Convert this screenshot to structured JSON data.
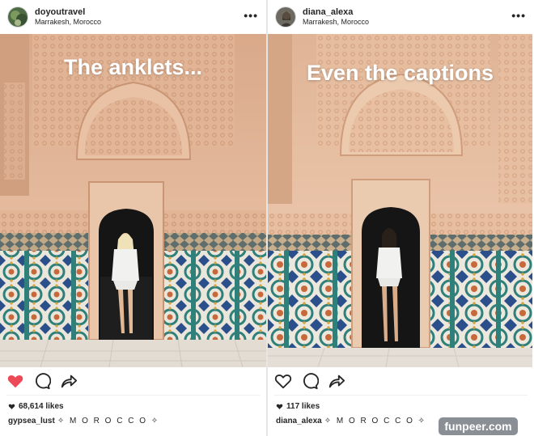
{
  "posts": [
    {
      "username": "doyoutravel",
      "location": "Marrakesh, Morocco",
      "more_label": "•••",
      "overlay_text": "The anklets...",
      "liked": true,
      "likes_text": "68,614 likes",
      "caption_user": "gypsea_lust",
      "caption_text": "✧ M O R O C C O ✧",
      "icons": [
        "heart-filled-icon",
        "comment-icon",
        "share-icon"
      ]
    },
    {
      "username": "diana_alexa",
      "location": "Marrakesh, Morocco",
      "more_label": "•••",
      "overlay_text": "Even the captions",
      "liked": false,
      "likes_text": "117 likes",
      "caption_user": "diana_alexa",
      "caption_text": "✧ M O R O C C O ✧",
      "icons": [
        "heart-outline-icon",
        "comment-icon",
        "share-icon"
      ]
    }
  ],
  "watermark": "funpeer.com",
  "colors": {
    "like_red": "#ed4956",
    "text": "#262626",
    "wall": "#e4b99a",
    "tile_teal": "#2f7f7a"
  }
}
